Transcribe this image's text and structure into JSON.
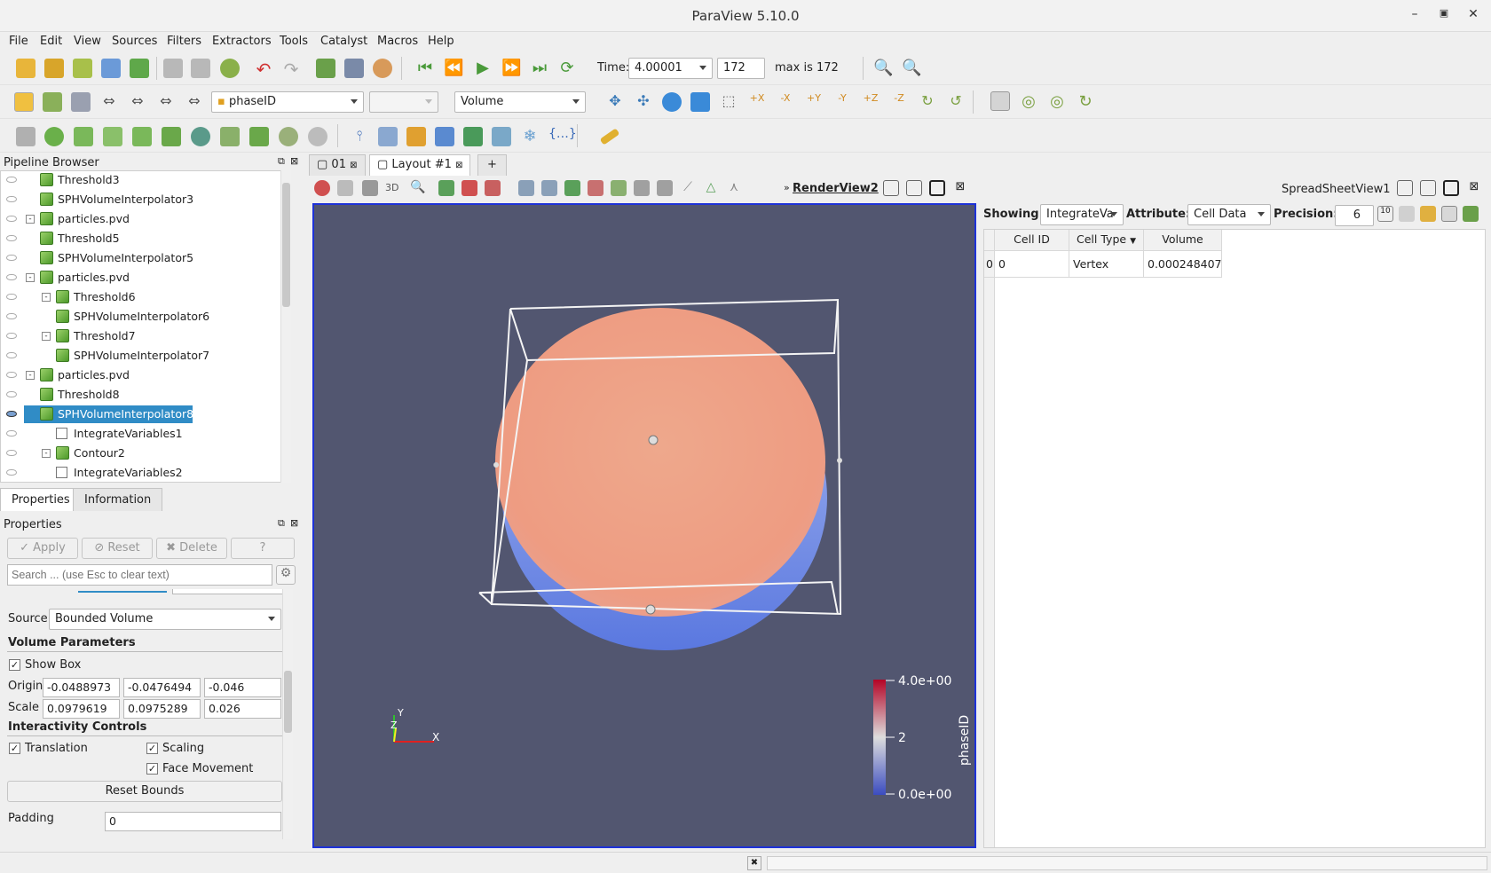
{
  "window": {
    "title": "ParaView 5.10.0"
  },
  "menu": [
    "File",
    "Edit",
    "View",
    "Sources",
    "Filters",
    "Extractors",
    "Tools",
    "Catalyst",
    "Macros",
    "Help"
  ],
  "time_toolbar": {
    "time_label": "Time:",
    "time_value": "4.00001",
    "step_value": "172",
    "max_text": "max is 172"
  },
  "display_toolbar": {
    "color_by": "phaseID",
    "component": "",
    "representation": "Volume"
  },
  "pipeline": {
    "title": "Pipeline Browser",
    "items": [
      {
        "label": "Threshold3",
        "indent": 1,
        "icon": "cube",
        "expand": ""
      },
      {
        "label": "SPHVolumeInterpolator3",
        "indent": 1,
        "icon": "cube",
        "expand": ""
      },
      {
        "label": "particles.pvd",
        "indent": 1,
        "icon": "cube",
        "expand": "-"
      },
      {
        "label": "Threshold5",
        "indent": 1,
        "icon": "cube",
        "expand": ""
      },
      {
        "label": "SPHVolumeInterpolator5",
        "indent": 1,
        "icon": "cube",
        "expand": ""
      },
      {
        "label": "particles.pvd",
        "indent": 1,
        "icon": "cube",
        "expand": "-"
      },
      {
        "label": "Threshold6",
        "indent": 2,
        "icon": "cube",
        "expand": "-"
      },
      {
        "label": "SPHVolumeInterpolator6",
        "indent": 2,
        "icon": "cube",
        "expand": ""
      },
      {
        "label": "Threshold7",
        "indent": 2,
        "icon": "cube",
        "expand": "-"
      },
      {
        "label": "SPHVolumeInterpolator7",
        "indent": 2,
        "icon": "cube",
        "expand": ""
      },
      {
        "label": "particles.pvd",
        "indent": 1,
        "icon": "cube",
        "expand": "-"
      },
      {
        "label": "Threshold8",
        "indent": 1,
        "icon": "cube",
        "expand": ""
      },
      {
        "label": "SPHVolumeInterpolator8",
        "indent": 1,
        "icon": "cube",
        "expand": "",
        "selected": true
      },
      {
        "label": "IntegrateVariables1",
        "indent": 2,
        "icon": "table",
        "expand": ""
      },
      {
        "label": "Contour2",
        "indent": 2,
        "icon": "cube",
        "expand": "-"
      },
      {
        "label": "IntegrateVariables2",
        "indent": 2,
        "icon": "table",
        "expand": ""
      }
    ]
  },
  "properties_panel": {
    "tabs": [
      "Properties",
      "Information"
    ],
    "title": "Properties",
    "apply_label": "Apply",
    "reset_label": "Reset",
    "delete_label": "Delete",
    "help_label": "?",
    "search_placeholder": "Search ... (use Esc to clear text)",
    "source_label": "Source",
    "source_value": "Bounded Volume",
    "volume_params_header": "Volume Parameters",
    "show_box_label": "Show Box",
    "origin_label": "Origin",
    "origin": [
      "-0.0488973",
      "-0.0476494",
      "-0.046"
    ],
    "scale_label": "Scale",
    "scale": [
      "0.0979619",
      "0.0975289",
      "0.026"
    ],
    "interactivity_header": "Interactivity Controls",
    "translation_label": "Translation",
    "scaling_label": "Scaling",
    "face_movement_label": "Face Movement",
    "reset_bounds_label": "Reset Bounds",
    "padding_label": "Padding",
    "padding_value": "0"
  },
  "layout_tabs": {
    "tab1": "01",
    "tab2": "Layout #1",
    "add": "+"
  },
  "render_view": {
    "name": "RenderView2",
    "three_d": "3D",
    "colorbar": {
      "title": "phaseID",
      "max": "4.0e+00",
      "mid": "2",
      "min": "0.0e+00"
    },
    "axes": {
      "x": "X",
      "y": "Y",
      "z": "Z"
    }
  },
  "spreadsheet": {
    "name": "SpreadSheetView1",
    "showing_label": "Showing",
    "showing_value": "IntegrateVa",
    "attribute_label": "Attribute:",
    "attribute_value": "Cell Data",
    "precision_label": "Precision:",
    "precision_value": "6",
    "columns": [
      "Cell ID",
      "Cell Type",
      "Volume"
    ],
    "rows": [
      {
        "index": "0",
        "cells": [
          "0",
          "Vertex",
          "0.000248407"
        ]
      }
    ]
  },
  "colors": {
    "accent": "#1e32d8",
    "selection": "#308cc6",
    "background": "#525670"
  }
}
